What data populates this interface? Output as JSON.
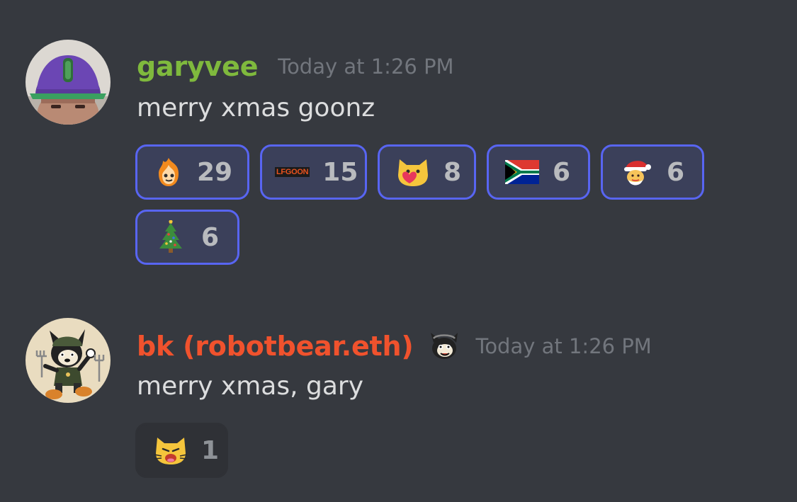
{
  "colors": {
    "background": "#36393f",
    "garyvee_name": "#7fb93d",
    "bk_name": "#f0522d",
    "timestamp": "#72767d",
    "message_text": "#dcddde",
    "reaction_selected_bg": "#3b405a",
    "reaction_selected_border": "#5865f2",
    "reaction_unselected_bg": "#2f3136"
  },
  "messages": [
    {
      "username": "garyvee",
      "timestamp": "Today at 1:26 PM",
      "content": "merry xmas goonz",
      "avatar_icon": "garyvee-avatar",
      "reactions": [
        {
          "emoji_icon": "fire-goon-emoji",
          "count": "29",
          "selected": true
        },
        {
          "emoji_icon": "lfgoon-emoji",
          "emoji_text": "LFGOON",
          "count": "15",
          "selected": true
        },
        {
          "emoji_icon": "heart-cat-emoji",
          "count": "8",
          "selected": true
        },
        {
          "emoji_icon": "south-africa-flag-emoji",
          "count": "6",
          "selected": true
        },
        {
          "emoji_icon": "santa-emoji",
          "count": "6",
          "selected": true
        },
        {
          "emoji_icon": "christmas-tree-emoji",
          "count": "6",
          "selected": true
        }
      ]
    },
    {
      "username": "bk (robotbear.eth)",
      "badge_icon": "goon-badge-icon",
      "timestamp": "Today at 1:26 PM",
      "content": "merry xmas, gary",
      "avatar_icon": "bk-avatar",
      "reactions": [
        {
          "emoji_icon": "yelling-cat-emoji",
          "count": "1",
          "selected": false
        }
      ]
    }
  ]
}
